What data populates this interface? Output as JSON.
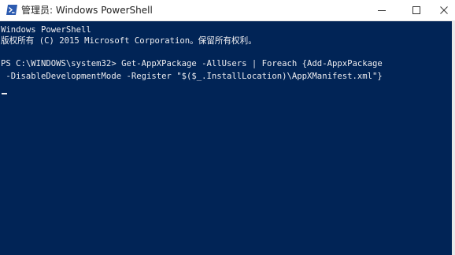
{
  "window": {
    "title": "管理员: Windows PowerShell",
    "colors": {
      "console_background": "#012456",
      "console_text": "#eeedf0",
      "titlebar_background": "#ffffff"
    },
    "controls": {
      "minimize_icon": "minimize-icon",
      "maximize_icon": "maximize-icon",
      "close_icon": "close-icon"
    }
  },
  "console": {
    "lines": [
      "Windows PowerShell",
      "版权所有 (C) 2015 Microsoft Corporation。保留所有权利。",
      "",
      "PS C:\\WINDOWS\\system32> Get-AppXPackage -AllUsers | Foreach {Add-AppxPackage",
      " -DisableDevelopmentMode -Register \"$($_.InstallLocation)\\AppXManifest.xml\"}"
    ]
  }
}
